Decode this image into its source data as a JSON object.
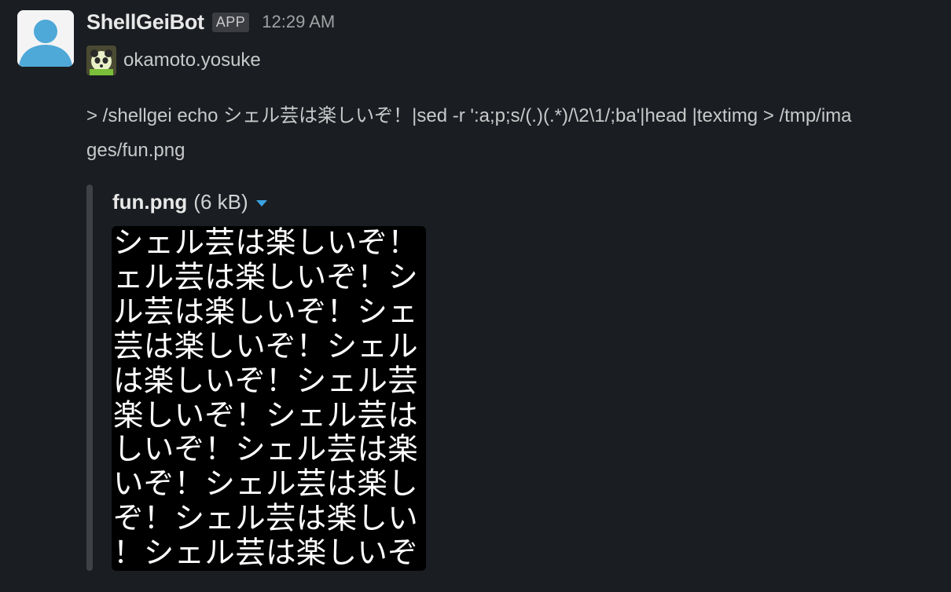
{
  "bot": {
    "name": "ShellGeiBot",
    "badge": "APP",
    "time": "12:29 AM"
  },
  "author": {
    "name": "okamoto.yosuke"
  },
  "message": {
    "command": "> /shellgei echo シェル芸は楽しいぞ！|sed -r ':a;p;s/(.)(.*)/\\2\\1/;ba'|head |textimg > /tmp/images/fun.png"
  },
  "attachment": {
    "file_name": "fun.png",
    "file_size": "(6 kB)",
    "image_lines": [
      "シェル芸は楽しいぞ！",
      "ェル芸は楽しいぞ！シ",
      "ル芸は楽しいぞ！シェ",
      "芸は楽しいぞ！シェル",
      "は楽しいぞ！シェル芸",
      "楽しいぞ！シェル芸は",
      "しいぞ！シェル芸は楽",
      "いぞ！シェル芸は楽し",
      "ぞ！シェル芸は楽しい",
      "！シェル芸は楽しいぞ"
    ]
  },
  "icons": {
    "bot_avatar": "default-user-avatar-icon",
    "user_avatar": "panda-avatar-icon",
    "caret": "chevron-down-icon"
  },
  "colors": {
    "background": "#1a1d21",
    "accent": "#3aa3e3",
    "avatar_blue": "#4ea8d8"
  }
}
